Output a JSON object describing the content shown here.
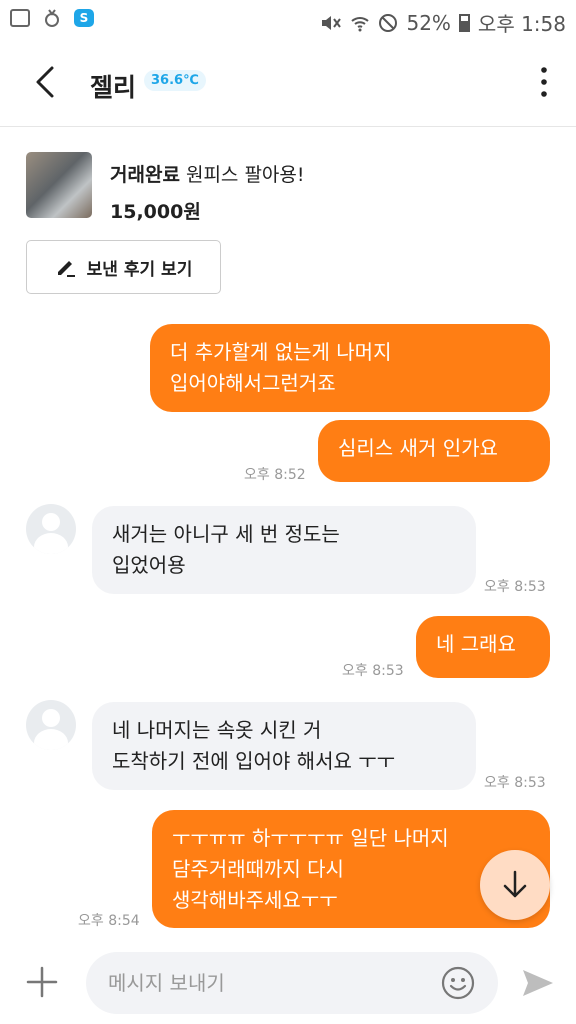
{
  "status_bar": {
    "battery": "52%",
    "time": "오후 1:58",
    "app_badge": "S"
  },
  "header": {
    "title": "젤리",
    "temperature": "36.6℃"
  },
  "product": {
    "status": "거래완료",
    "name": "원피스 팔아용!",
    "price": "15,000원",
    "review_button": "보낸 후기 보기"
  },
  "messages": [
    {
      "text": "더 추가할게 없는게 나머지\n입어야해서그런거죠",
      "time": ""
    },
    {
      "text": "심리스 새거 인가요",
      "time": "오후 8:52"
    },
    {
      "text": "새거는 아니구 세 번 정도는\n입었어용",
      "time": "오후 8:53"
    },
    {
      "text": "네 그래요",
      "time": "오후 8:53"
    },
    {
      "text": "네 나머지는 속옷 시킨 거\n도착하기 전에 입어야 해서요 ㅜㅜ",
      "time": "오후 8:53"
    },
    {
      "text": "ㅜㅜㅠㅠ  하ㅜㅜㅜㅠ 일단 나머지\n담주거래때까지 다시\n생각해바주세요ㅜㅜ",
      "time": "오후 8:54"
    }
  ],
  "input": {
    "placeholder": "메시지 보내기"
  },
  "colors": {
    "accent": "#ff7e14",
    "temperature": "#1ea6e8",
    "incoming_bubble": "#f2f3f6"
  }
}
